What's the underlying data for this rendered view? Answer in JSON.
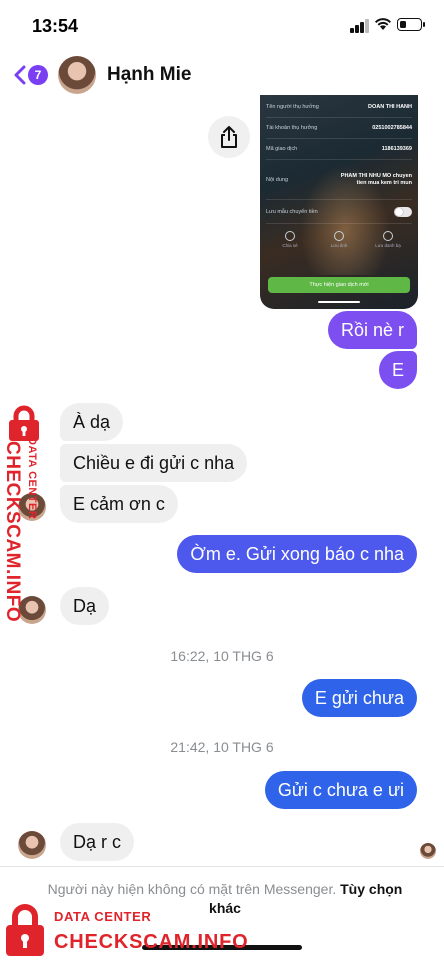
{
  "status_bar": {
    "time": "13:54",
    "battery_level": 0.35
  },
  "header": {
    "back_badge_count": "7",
    "contact_name": "Hạnh Mie"
  },
  "receipt": {
    "rows": [
      {
        "label": "Tên người thụ hưởng",
        "value": "DOAN THI HANH"
      },
      {
        "label": "Tài khoản thụ hưởng",
        "value": "0251002785844"
      },
      {
        "label": "Mã giao dịch",
        "value": "1186139369"
      }
    ],
    "content_label": "Nội dung",
    "content_value": "PHAM THI NHU MO chuyen tien mua kem tri mun",
    "save_label": "Lưu mẫu chuyển tiền",
    "actions": [
      "Chia sẻ",
      "Lưu ảnh",
      "Lưu danh bạ"
    ],
    "new_transaction": "Thực hiện giao dịch mới"
  },
  "messages": [
    {
      "side": "out",
      "text": "Rồi nè r"
    },
    {
      "side": "out",
      "text": "E"
    },
    {
      "side": "in",
      "text": "À dạ"
    },
    {
      "side": "in",
      "text": "Chiều e đi gửi c nha"
    },
    {
      "side": "in",
      "text": "E cảm ơn c"
    },
    {
      "side": "out",
      "text": "Ờm e. Gửi xong báo c nha"
    },
    {
      "side": "in",
      "text": "Dạ"
    },
    {
      "side": "out",
      "text": "E gửi chưa"
    },
    {
      "side": "out",
      "text": "Gửi c chưa e ưi"
    },
    {
      "side": "in",
      "text": "Dạ r c"
    }
  ],
  "timestamps": [
    "16:22, 10 THG 6",
    "21:42, 10 THG 6"
  ],
  "footer": {
    "notice": "Người này hiện không có mặt trên Messenger.",
    "link": "Tùy chọn khác"
  },
  "watermark": {
    "small": "DATA CENTER",
    "big": "CHECKSCAM.INFO"
  },
  "colors": {
    "outgoing_purple": "#7e4ff0",
    "outgoing_blue": "#2f63e9",
    "incoming": "#efefef",
    "watermark_red": "#e0242b"
  }
}
